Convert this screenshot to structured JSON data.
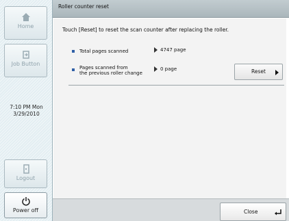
{
  "window": {
    "title": "Roller counter reset"
  },
  "sidebar": {
    "home_label": "Home",
    "job_button_label": "Job Button",
    "clock": {
      "time": "7:10 PM  Mon",
      "date": "3/29/2010"
    },
    "logout_label": "Logout",
    "power_off_label": "Power off"
  },
  "main": {
    "instruction": "Touch [Reset] to reset the scan counter after replacing the roller.",
    "total_pages": {
      "label": "Total pages scanned",
      "value": "4747 page"
    },
    "since_change": {
      "label_line1": "Pages scanned from",
      "label_line2": "the previous roller change",
      "value": "0 page"
    },
    "reset_label": "Reset"
  },
  "footer": {
    "close_label": "Close"
  },
  "colors": {
    "marker": "#2f5fa6",
    "sidebar_bg": "#e3eef2",
    "titlebar": "#b6c1c5"
  }
}
